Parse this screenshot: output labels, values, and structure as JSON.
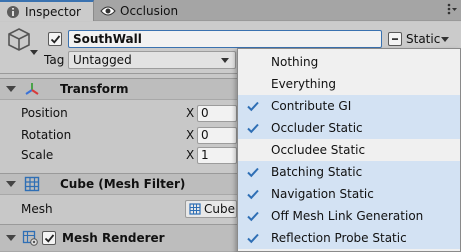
{
  "tabs": [
    {
      "label": "Inspector",
      "icon": "info-icon",
      "active": true
    },
    {
      "label": "Occlusion",
      "icon": "eye-icon",
      "active": false
    }
  ],
  "object": {
    "name": "SouthWall",
    "active": true,
    "static_label": "Static",
    "tag_label": "Tag",
    "tag_value": "Untagged"
  },
  "components": [
    {
      "title": "Transform",
      "icon": "transform-axes-icon",
      "properties": [
        {
          "label": "Position",
          "axis": "X",
          "value": "0"
        },
        {
          "label": "Rotation",
          "axis": "X",
          "value": "0"
        },
        {
          "label": "Scale",
          "axis": "X",
          "value": "1"
        }
      ]
    },
    {
      "title": "Cube (Mesh Filter)",
      "icon": "mesh-grid-icon",
      "properties": [
        {
          "label": "Mesh",
          "value": "Cube"
        }
      ]
    },
    {
      "title": "Mesh Renderer",
      "icon": "mesh-renderer-icon",
      "enabled": true
    }
  ],
  "static_menu": {
    "items": [
      {
        "label": "Nothing",
        "checked": false
      },
      {
        "label": "Everything",
        "checked": false
      },
      {
        "label": "Contribute GI",
        "checked": true
      },
      {
        "label": "Occluder Static",
        "checked": true
      },
      {
        "label": "Occludee Static",
        "checked": false
      },
      {
        "label": "Batching Static",
        "checked": true
      },
      {
        "label": "Navigation Static",
        "checked": true
      },
      {
        "label": "Off Mesh Link Generation",
        "checked": true
      },
      {
        "label": "Reflection Probe Static",
        "checked": true
      }
    ]
  },
  "colors": {
    "accent": "#3a72b0",
    "check": "#2f6fb5",
    "checked_row": "#d3e2f3"
  }
}
